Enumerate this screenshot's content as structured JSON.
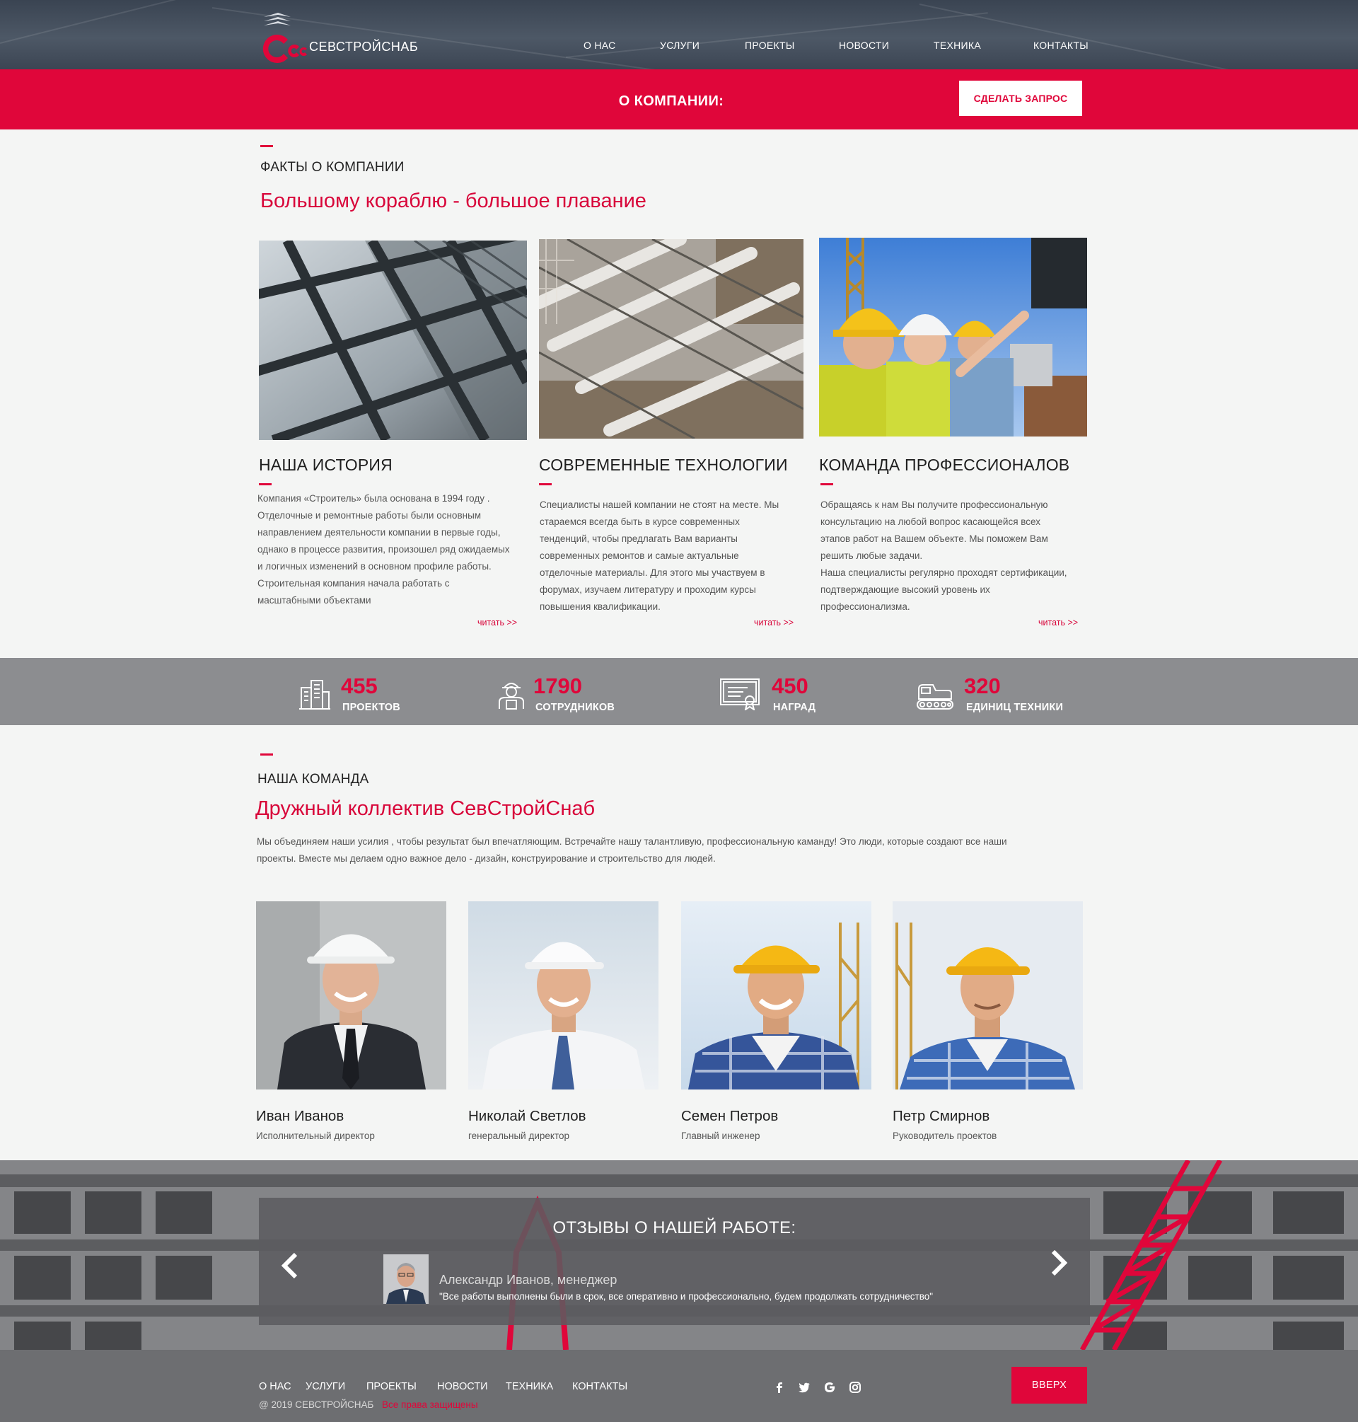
{
  "brand": {
    "name": "СЕВСТРОЙСНАБ",
    "accent": "#e0063a"
  },
  "nav": [
    "О НАС",
    "УСЛУГИ",
    "ПРОЕКТЫ",
    "НОВОСТИ",
    "ТЕХНИКА",
    "КОНТАКТЫ"
  ],
  "redbar": {
    "title": "О КОМПАНИИ:",
    "request_button": "СДЕЛАТЬ ЗАПРОС"
  },
  "facts": {
    "kicker": "ФАКТЫ О КОМПАНИИ",
    "headline": "Большому кораблю  - большое плавание",
    "cards": [
      {
        "title": "НАША ИСТОРИЯ",
        "lines": [
          "Компания «Строитель» была основана в 1994 году .",
          "Отделочные и ремонтные работы были основным",
          "направлением деятельности компании в первые годы,",
          "однако в процессе развития, произошел ряд ожидаемых",
          "и логичных изменений в основном профиле работы.",
          "Строительная компания начала работать с",
          "масштабными объектами"
        ],
        "more": "читать >>"
      },
      {
        "title": "СОВРЕМЕННЫЕ ТЕХНОЛОГИИ",
        "lines": [
          "Специалисты нашей компании не стоят на месте. Мы",
          "стараемся всегда быть в курсе современных",
          "тенденций, чтобы предлагать Вам варианты",
          "современных ремонтов и самые актуальные",
          "отделочные материалы. Для этого мы участвуем в",
          "форумах, изучаем литературу и проходим курсы",
          "повышения квалификации."
        ],
        "more": "читать >>"
      },
      {
        "title": "КОМАНДА ПРОФЕССИОНАЛОВ",
        "lines": [
          "Обращаясь к нам Вы получите профессиональную",
          "консультацию на любой вопрос касающейся всех",
          "этапов работ на Вашем объекте. Мы поможем Вам",
          "решить любые задачи.",
          "Наша специалисты регулярно проходят сертификации,",
          "подтверждающие высокий уровень их",
          "профессионализма."
        ],
        "more": "читать >>"
      }
    ]
  },
  "stats": [
    {
      "value": "455",
      "label": "ПРОЕКТОВ",
      "icon": "buildings-icon"
    },
    {
      "value": "1790",
      "label": "СОТРУДНИКОВ",
      "icon": "worker-icon"
    },
    {
      "value": "450",
      "label": "НАГРАД",
      "icon": "certificate-icon"
    },
    {
      "value": "320",
      "label": "ЕДИНИЦ ТЕХНИКИ",
      "icon": "machinery-icon"
    }
  ],
  "team": {
    "kicker": "НАША КОМАНДА",
    "headline": "Дружный коллектив СевСтройСнаб",
    "intro_lines": [
      "Мы объединяем наши усилия , чтобы результат был впечатляющим. Встречайте нашу талантливую, профессиональную каманду! Это люди, которые создают все наши",
      "проекты. Вместе мы делаем одно важное дело - дизайн, конструирование и строительство для людей."
    ],
    "members": [
      {
        "name": "Иван Иванов",
        "role": "Исполнительный директор"
      },
      {
        "name": "Николай Светлов",
        "role": "генеральный директор"
      },
      {
        "name": "Семен Петров",
        "role": "Главный инженер"
      },
      {
        "name": "Петр Смирнов",
        "role": "Руководитель проектов"
      }
    ]
  },
  "reviews": {
    "title": "ОТЗЫВЫ О НАШЕЙ РАБОТЕ:",
    "author": "Александр Иванов, менеджер",
    "text": "\"Все работы выполнены были в срок, все оперативно и профессионально, будем продолжать сотрудничество\""
  },
  "footer": {
    "nav": [
      "О НАС",
      "УСЛУГИ",
      "ПРОЕКТЫ",
      "НОВОСТИ",
      "ТЕХНИКА",
      "КОНТАКТЫ"
    ],
    "copyright": "@ 2019 СЕВСТРОЙСНАБ",
    "rights": "Все права защищены",
    "social": [
      "facebook-icon",
      "twitter-icon",
      "google-icon",
      "instagram-icon"
    ],
    "top_button": "ВВЕРХ"
  }
}
